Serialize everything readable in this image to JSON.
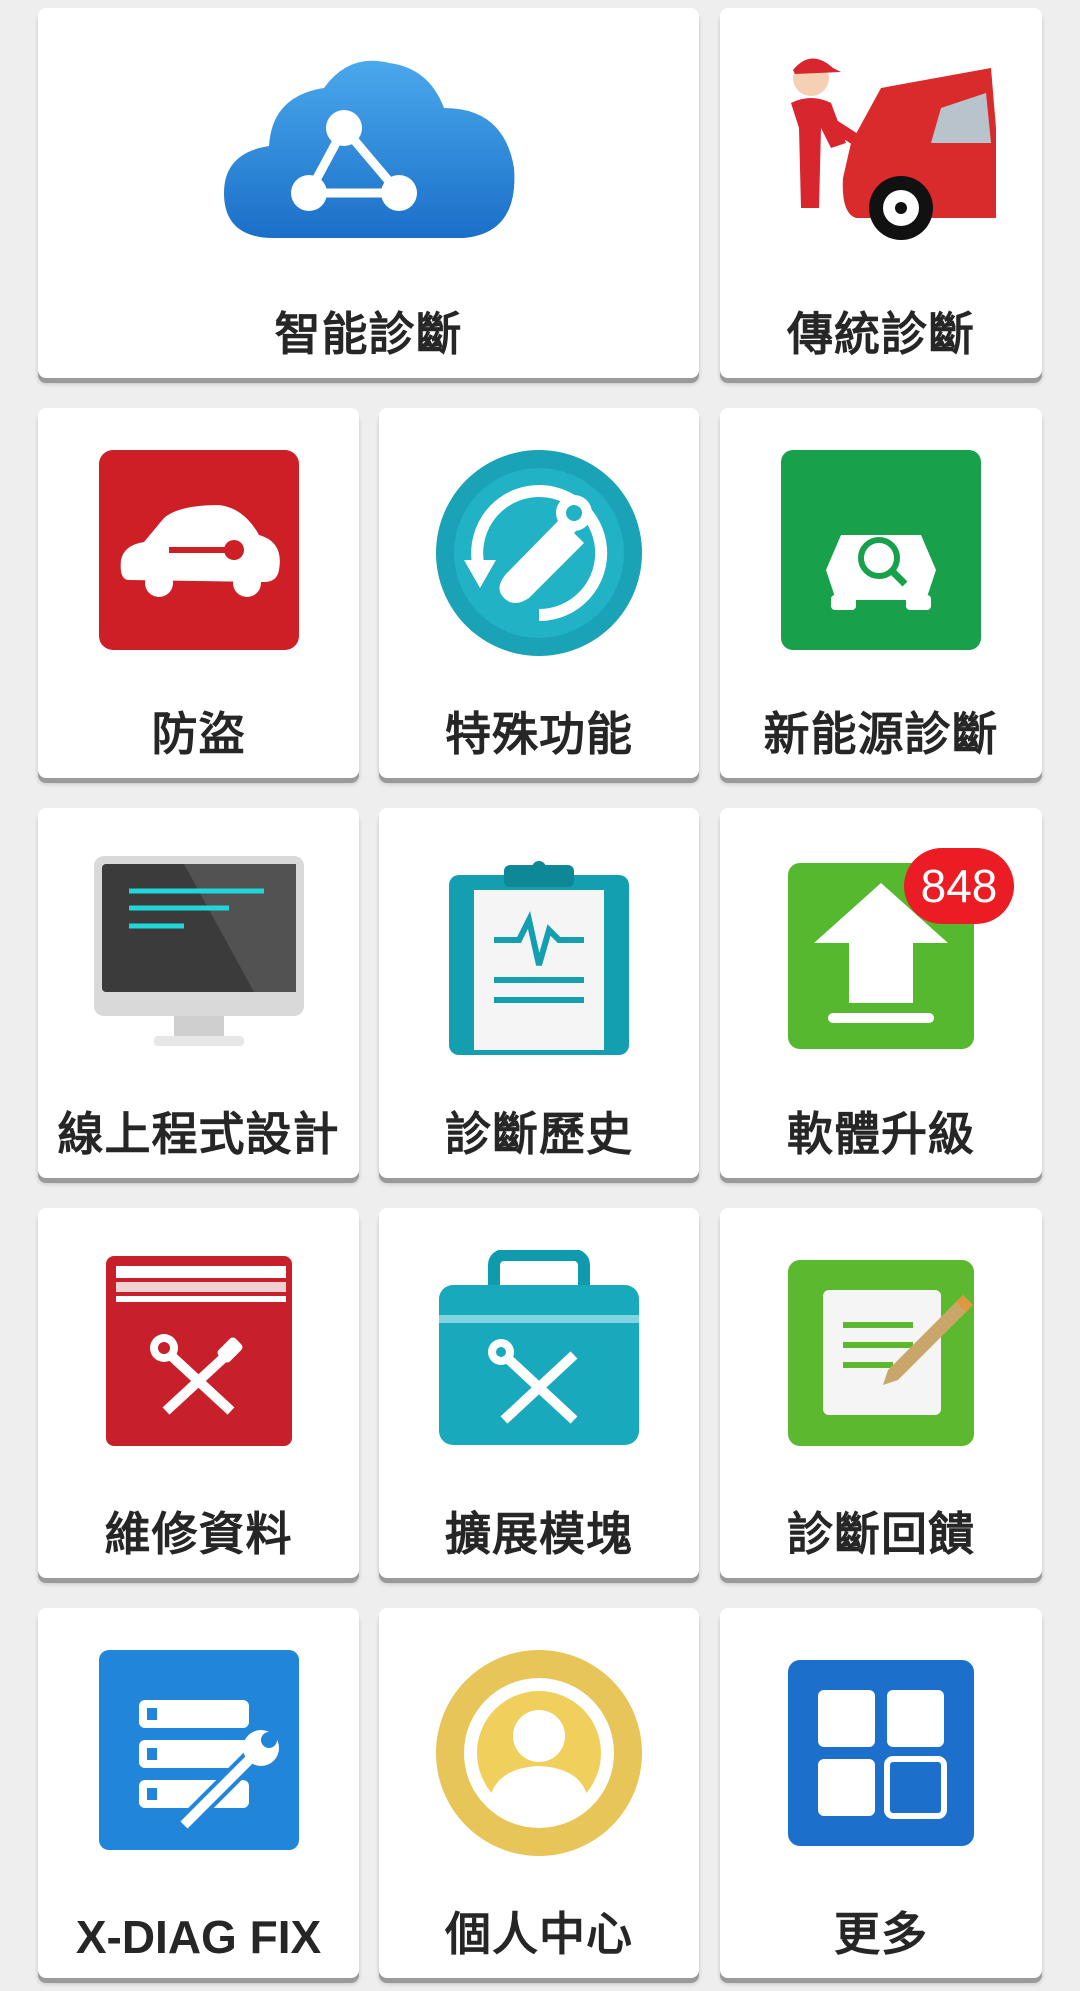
{
  "tiles": [
    {
      "label": "智能診斷",
      "icon": "cloud-network-icon"
    },
    {
      "label": "傳統診斷",
      "icon": "mechanic-car-icon"
    },
    {
      "label": "防盜",
      "icon": "car-key-icon"
    },
    {
      "label": "特殊功能",
      "icon": "wrench-cycle-icon"
    },
    {
      "label": "新能源診斷",
      "icon": "ev-car-search-icon"
    },
    {
      "label": "線上程式設計",
      "icon": "monitor-code-icon"
    },
    {
      "label": "診斷歷史",
      "icon": "clipboard-waveform-icon"
    },
    {
      "label": "軟體升級",
      "icon": "upload-arrow-icon",
      "badge": "848"
    },
    {
      "label": "維修資料",
      "icon": "repair-book-icon"
    },
    {
      "label": "擴展模塊",
      "icon": "toolbox-icon"
    },
    {
      "label": "診斷回饋",
      "icon": "feedback-note-icon"
    },
    {
      "label": "X-DIAG FIX",
      "icon": "server-wrench-icon"
    },
    {
      "label": "個人中心",
      "icon": "user-profile-icon"
    },
    {
      "label": "更多",
      "icon": "more-grid-icon"
    }
  ],
  "colors": {
    "background": "#eeeeee",
    "tile": "#ffffff",
    "label_text": "#262626",
    "badge": "#ec1c24"
  }
}
